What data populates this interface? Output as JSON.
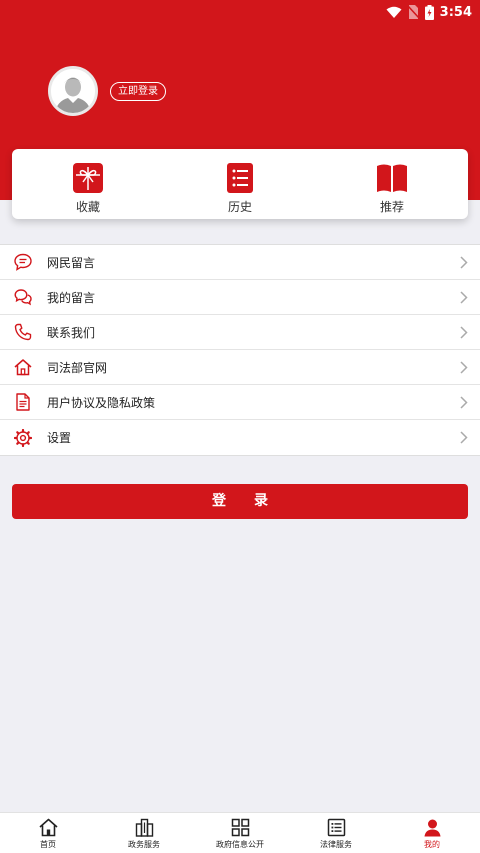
{
  "status_bar": {
    "time": "3:54"
  },
  "profile": {
    "login_link": "立即登录"
  },
  "quick_actions": [
    {
      "label": "收藏",
      "icon": "gift-icon"
    },
    {
      "label": "历史",
      "icon": "list-icon"
    },
    {
      "label": "推荐",
      "icon": "book-icon"
    }
  ],
  "menu": [
    {
      "label": "网民留言",
      "icon": "message-icon"
    },
    {
      "label": "我的留言",
      "icon": "chat-icon"
    },
    {
      "label": "联系我们",
      "icon": "phone-icon"
    },
    {
      "label": "司法部官网",
      "icon": "home-icon"
    },
    {
      "label": "用户协议及隐私政策",
      "icon": "document-icon"
    },
    {
      "label": "设置",
      "icon": "gear-icon"
    }
  ],
  "login_button": "登录",
  "tabs": [
    {
      "label": "首页",
      "icon": "home-icon",
      "active": false
    },
    {
      "label": "政务服务",
      "icon": "building-icon",
      "active": false
    },
    {
      "label": "政府信息公开",
      "icon": "grid-icon",
      "active": false
    },
    {
      "label": "法律服务",
      "icon": "list-icon",
      "active": false
    },
    {
      "label": "我的",
      "icon": "person-icon",
      "active": true
    }
  ],
  "colors": {
    "brand_red": "#d2161b",
    "background": "#efeff4"
  }
}
